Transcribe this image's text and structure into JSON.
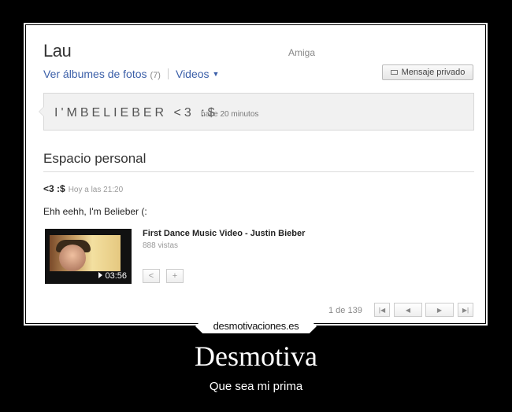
{
  "profile": {
    "name": "Lau",
    "relation": "Amiga",
    "photos_label": "Ver álbumes de fotos",
    "photos_count": "(7)",
    "videos_label": "Videos",
    "message_button": "Mensaje privado"
  },
  "status": {
    "text": "I'MBELIEBER <3 :$",
    "time": "hace 20 minutos"
  },
  "personal_space": {
    "title": "Espacio personal",
    "post": {
      "author": "<3 :$",
      "time": "Hoy a las 21:20",
      "body": "Ehh eehh, I'm Belieber (:",
      "video": {
        "title": "First Dance Music Video - Justin Bieber",
        "views": "888 vistas",
        "duration": "03:56",
        "share_symbol": "<",
        "add_symbol": "+"
      }
    },
    "pager": {
      "label": "1 de 139",
      "first": "|◀",
      "prev": "◀",
      "next": "▶",
      "last": "▶|"
    }
  },
  "poster": {
    "site": "desmotivaciones.es",
    "title": "Desmotiva",
    "subtitle": "Que sea mi prima"
  }
}
